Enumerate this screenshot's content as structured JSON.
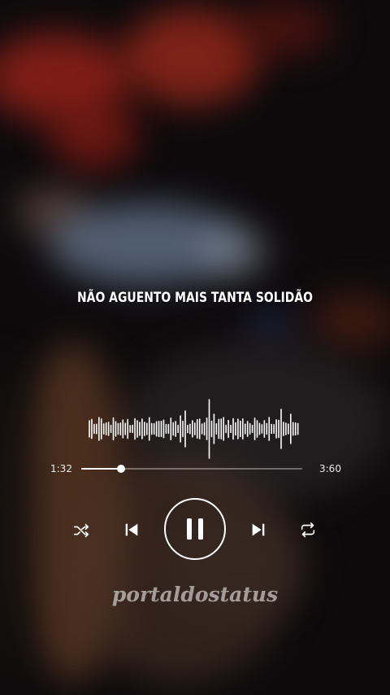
{
  "lyric": "NÃO AGUENTO MAIS TANTA SOLIDÃO",
  "player": {
    "elapsed": "1:32",
    "duration": "3:60",
    "progress": 0.18
  },
  "controls": {
    "shuffle": "shuffle-icon",
    "previous": "skip-previous-icon",
    "play_pause": "pause-icon",
    "next": "skip-next-icon",
    "repeat": "repeat-icon"
  },
  "watermark": "portaldostatus",
  "colors": {
    "text": "#ffffff",
    "neon_red": "#d8301c",
    "street_light": "#9fb6d6"
  }
}
